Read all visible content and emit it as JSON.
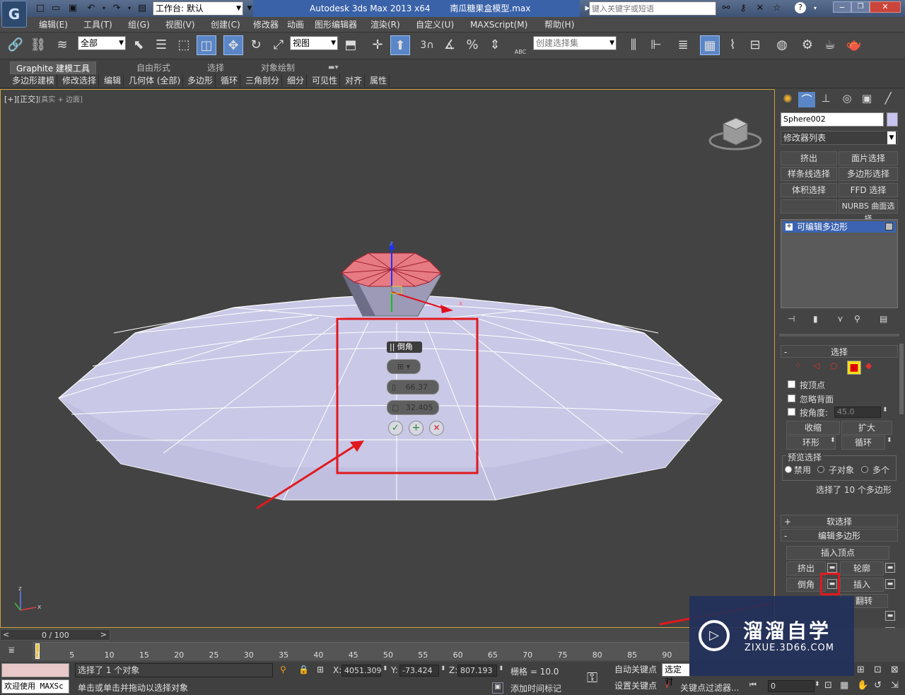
{
  "titlebar": {
    "workspace_value": "工作台: 默认",
    "app_title": "Autodesk 3ds Max  2013 x64",
    "file_title": "南瓜糖果盒模型.max",
    "search_placeholder": "键入关键字或短语"
  },
  "menu": [
    "编辑(E)",
    "工具(T)",
    "组(G)",
    "视图(V)",
    "创建(C)",
    "修改器",
    "动画",
    "图形编辑器",
    "渲染(R)",
    "自定义(U)",
    "MAXScript(M)",
    "帮助(H)"
  ],
  "toolbar": {
    "filter_value": "全部",
    "refcoord_value": "视图",
    "num_3": "3",
    "abc": "ABC",
    "selset_placeholder": "创建选择集"
  },
  "ribbon": {
    "tabs": [
      "Graphite 建模工具",
      "自由形式",
      "选择",
      "对象绘制"
    ],
    "buttons": [
      "多边形建模",
      "修改选择",
      "编辑",
      "几何体 (全部)",
      "多边形",
      "循环",
      "三角剖分",
      "细分",
      "可见性",
      "对齐",
      "属性"
    ]
  },
  "viewport": {
    "label_plus": "[+]",
    "label_view": "[正交]",
    "label_shade": "[真实 + 边面]",
    "caddy": {
      "title": "倒角",
      "height_value": "66.37",
      "outline_value": "32.405"
    }
  },
  "cmdpanel": {
    "object_name": "Sphere002",
    "modifier_list": "修改器列表",
    "mod_buttons": [
      "挤出",
      "面片选择",
      "样条线选择",
      "多边形选择",
      "体积选择",
      "FFD 选择",
      "",
      "NURBS 曲面选择"
    ],
    "stack_item": "可编辑多边形",
    "select_rollout": {
      "title": "选择",
      "by_vertex": "按顶点",
      "ignore_backface": "忽略背面",
      "by_angle": "按角度:",
      "angle_value": "45.0",
      "shrink": "收缩",
      "grow": "扩大",
      "ring": "环形",
      "loop": "循环",
      "preview_title": "预览选择",
      "preview_disabled": "禁用",
      "preview_subobj": "子对象",
      "preview_multi": "多个",
      "status": "选择了 10 个多边形"
    },
    "soft_select": "软选择",
    "edit_poly": {
      "title": "编辑多边形",
      "insert_vertex": "插入顶点",
      "extrude": "挤出",
      "outline": "轮廓",
      "bevel": "倒角",
      "inset": "插入",
      "flip": "翻转",
      "partial_label": "分"
    }
  },
  "timeline": {
    "frame_counter": "0 / 100",
    "ticks": [
      "0",
      "5",
      "10",
      "15",
      "20",
      "25",
      "30",
      "35",
      "40",
      "45",
      "50",
      "55",
      "60",
      "65",
      "70",
      "75",
      "80",
      "85",
      "90"
    ]
  },
  "status": {
    "welcome": "欢迎使用 MAXSc",
    "selected": "选择了 1 个对象",
    "prompt": "单击或单击并拖动以选择对象",
    "x_label": "X:",
    "x_value": "4051.309",
    "y_label": "Y:",
    "y_value": "-73.424",
    "z_label": "Z:",
    "z_value": "807.193",
    "grid": "栅格 = 10.0",
    "add_time_tag": "添加时间标记",
    "auto_key": "自动关键点",
    "set_key": "设置关键点",
    "selected_dropdown": "选定对",
    "key_filters": "关键点过滤器...",
    "frame_value": "0"
  },
  "watermark": {
    "brand": "溜溜自学",
    "url": "ZIXUE.3D66.COM"
  },
  "colors": {
    "highlight_red": "#e0191f",
    "viewport_border": "#c9a33a",
    "selection_blue": "#3b63b1",
    "mesh_fill": "#c9c8e6"
  }
}
